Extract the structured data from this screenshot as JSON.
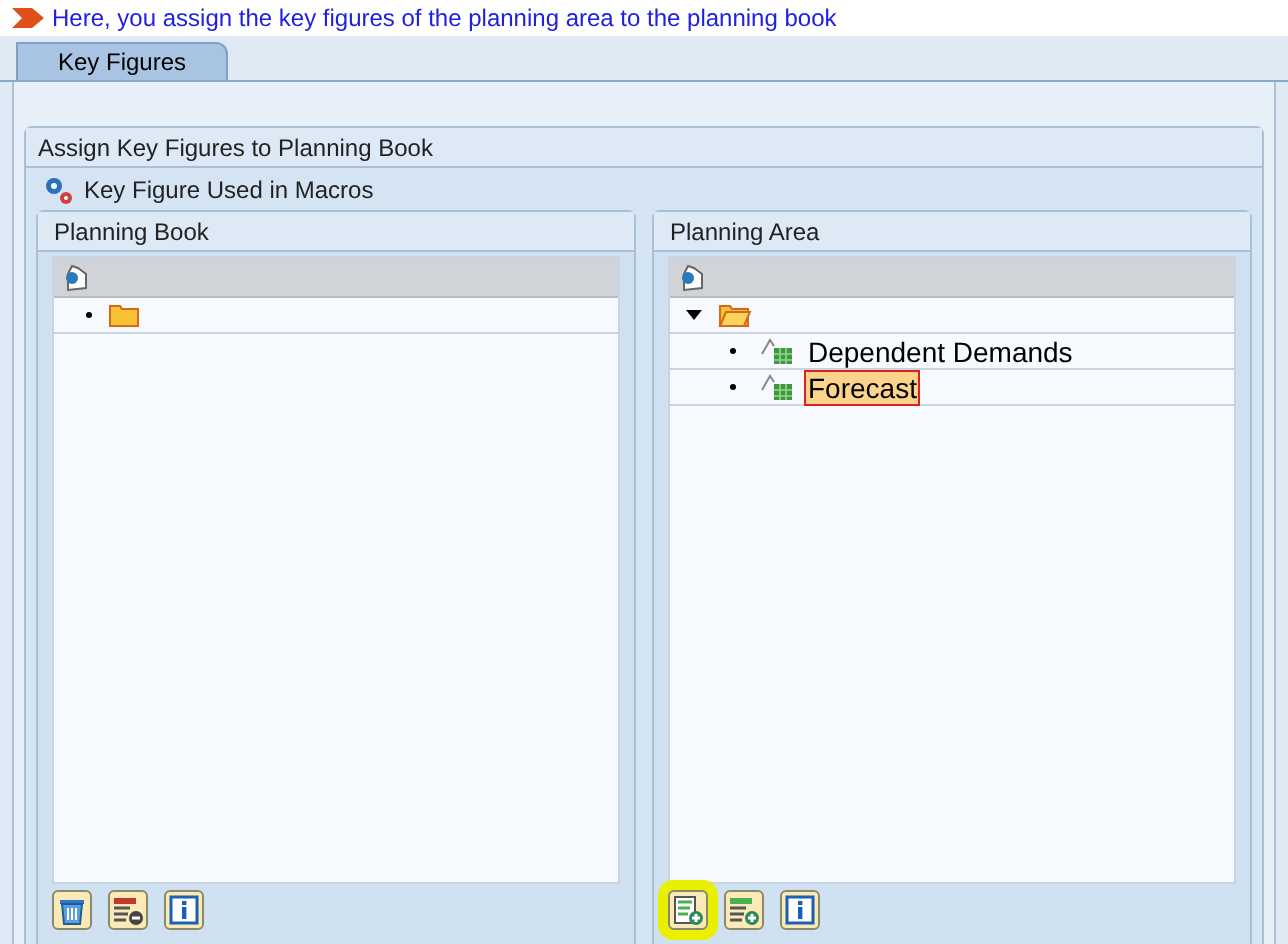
{
  "message": "Here, you assign the key figures of the planning area to the planning book",
  "tabs": [
    {
      "label": "Key Figures",
      "selected": true
    }
  ],
  "group_title": "Assign Key Figures to Planning Book",
  "macro_button": "Key Figure Used in Macros",
  "panels": [
    {
      "title": "Planning Book",
      "tree": [
        {
          "kind": "folder",
          "expanded": false
        }
      ],
      "buttons": [
        {
          "kind": "delete",
          "highlighted": false
        },
        {
          "kind": "remove",
          "highlighted": false
        },
        {
          "kind": "info",
          "highlighted": false
        }
      ]
    },
    {
      "title": "Planning Area",
      "tree": [
        {
          "kind": "folder",
          "expanded": true,
          "children": [
            {
              "kind": "key-figure",
              "label": "Dependent Demands",
              "selected": false
            },
            {
              "kind": "key-figure",
              "label": "Forecast",
              "selected": true
            }
          ]
        }
      ],
      "buttons": [
        {
          "kind": "add-doc",
          "highlighted": true
        },
        {
          "kind": "add",
          "highlighted": false
        },
        {
          "kind": "info",
          "highlighted": false
        }
      ]
    }
  ]
}
